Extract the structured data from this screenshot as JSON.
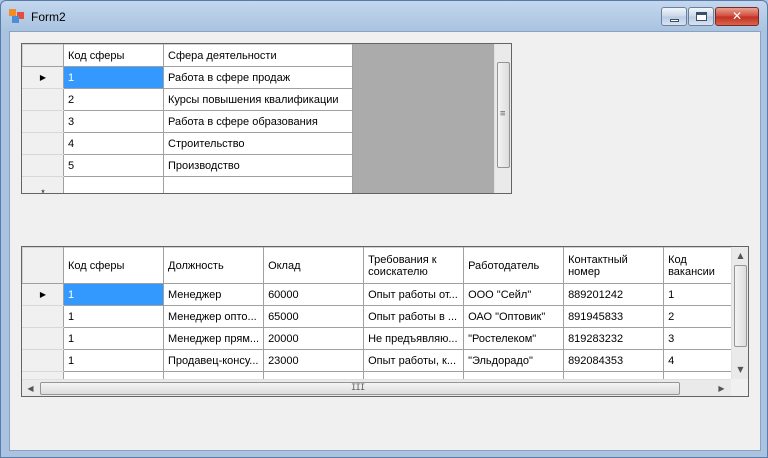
{
  "window": {
    "title": "Form2",
    "close_glyph": "✕"
  },
  "grid1": {
    "headers": [
      "Код сферы",
      "Сфера деятельности"
    ],
    "rows": [
      [
        "1",
        "Работа в сфере продаж"
      ],
      [
        "2",
        "Курсы повышения квалификации"
      ],
      [
        "3",
        "Работа в сфере образования"
      ],
      [
        "4",
        "Строительство"
      ],
      [
        "5",
        "Производство"
      ]
    ],
    "current_row_marker": "▶",
    "new_row_marker": "*",
    "scroll_grip": "≡"
  },
  "grid2": {
    "headers": [
      "Код сферы",
      "Должность",
      "Оклад",
      "Требования к\nсоискателю",
      "Работодатель",
      "Контактный\nномер",
      "Код\nвакансии"
    ],
    "rows": [
      [
        "1",
        "Менеджер",
        "60000",
        "Опыт работы от...",
        "ООО \"Сейл\"",
        "889201242",
        "1"
      ],
      [
        "1",
        "Менеджер опто...",
        "65000",
        "Опыт работы в ...",
        "ОАО \"Оптовик\"",
        "891945833",
        "2"
      ],
      [
        "1",
        "Менеджер прям...",
        "20000",
        "Не предъявляю...",
        "\"Ростелеком\"",
        "819283232",
        "3"
      ],
      [
        "1",
        "Продавец-консу...",
        "23000",
        "Опыт работы, к...",
        "\"Эльдорадо\"",
        "892084353",
        "4"
      ]
    ],
    "current_row_marker": "▶",
    "scroll_grip_h": "III",
    "arrows": {
      "up": "▲",
      "down": "▼",
      "left": "◀",
      "right": "▶"
    }
  },
  "colors": {
    "selection": "#3399ff",
    "grid_background": "#ababab",
    "form_background": "#f0f0f0"
  }
}
